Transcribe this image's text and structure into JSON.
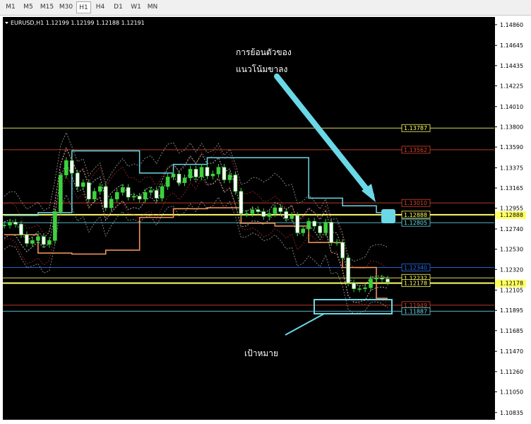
{
  "timeframes": [
    {
      "label": "M1",
      "active": false
    },
    {
      "label": "M5",
      "active": false
    },
    {
      "label": "M15",
      "active": false
    },
    {
      "label": "M30",
      "active": false
    },
    {
      "label": "H1",
      "active": true
    },
    {
      "label": "H4",
      "active": false
    },
    {
      "label": "D1",
      "active": false
    },
    {
      "label": "W1",
      "active": false
    },
    {
      "label": "MN",
      "active": false
    }
  ],
  "chart_header": {
    "symbol": "EURUSD,H1",
    "ohlc": "1.12199 1.12199 1.12188 1.12191"
  },
  "annotations": {
    "retrace_line1": "การย้อนตัวของ",
    "retrace_line2": "แนวโน้มขาลง",
    "target": "เป้าหมาย"
  },
  "colors": {
    "background": "#000000",
    "axis": "#ffffff",
    "yellow": "#ffff64",
    "red": "#d9442c",
    "blue": "#2b6ff0",
    "cyan": "#6ad8e6",
    "orange": "#ff9a5c",
    "green": "#3cd23c"
  },
  "chart_data": {
    "type": "candlestick",
    "symbol": "EURUSD",
    "timeframe": "H1",
    "last_price": 1.12178,
    "y_ticks": [
      1.1486,
      1.14645,
      1.14435,
      1.14225,
      1.1401,
      1.138,
      1.1359,
      1.13375,
      1.13165,
      1.12955,
      1.1274,
      1.1253,
      1.1232,
      1.12105,
      1.11895,
      1.11685,
      1.1147,
      1.1126,
      1.1105,
      1.10835
    ],
    "y_tick_labels": [
      "1.14860",
      "1.14645",
      "1.14435",
      "1.14225",
      "1.14010",
      "1.13800",
      "1.13590",
      "1.13375",
      "1.13165",
      "1.12955",
      "1.12740",
      "1.12530",
      "1.12320",
      "1.12105",
      "1.11895",
      "1.11685",
      "1.11470",
      "1.11260",
      "1.11050",
      "1.10835"
    ],
    "ylim": [
      1.1076,
      1.1494
    ],
    "levels": [
      {
        "value": 1.13787,
        "label": "1.13787",
        "color": "#ffff64"
      },
      {
        "value": 1.13562,
        "label": "1.13562",
        "color": "#d9442c"
      },
      {
        "value": 1.1301,
        "label": "1.13010",
        "color": "#d9442c"
      },
      {
        "value": 1.12888,
        "label": "1.12888",
        "color": "#ffff64",
        "highlight": true
      },
      {
        "value": 1.12805,
        "label": "1.12805",
        "color": "#6ad8e6"
      },
      {
        "value": 1.1234,
        "label": "1.12340",
        "color": "#2b6ff0"
      },
      {
        "value": 1.12232,
        "label": "1.12232",
        "color": "#ffff64"
      },
      {
        "value": 1.12178,
        "label": "1.12178",
        "color": "#ffff64",
        "highlight": true
      },
      {
        "value": 1.11949,
        "label": "1.11949",
        "color": "#d9442c"
      },
      {
        "value": 1.11887,
        "label": "1.11887",
        "color": "#6ad8e6"
      }
    ],
    "close": [
      1.1278,
      1.1281,
      1.1279,
      1.1268,
      1.1259,
      1.1262,
      1.1266,
      1.1258,
      1.1262,
      1.1292,
      1.133,
      1.1345,
      1.1332,
      1.1318,
      1.1322,
      1.1305,
      1.1313,
      1.1318,
      1.1296,
      1.1305,
      1.1312,
      1.1317,
      1.1307,
      1.1308,
      1.1305,
      1.1312,
      1.1314,
      1.1306,
      1.1318,
      1.1328,
      1.1331,
      1.1322,
      1.1327,
      1.1336,
      1.1328,
      1.1338,
      1.1329,
      1.1331,
      1.1338,
      1.1325,
      1.133,
      1.1313,
      1.129,
      1.129,
      1.1294,
      1.1292,
      1.1287,
      1.129,
      1.1296,
      1.1292,
      1.1285,
      1.1288,
      1.127,
      1.1274,
      1.1282,
      1.1277,
      1.127,
      1.1281,
      1.126,
      1.126,
      1.1244,
      1.1218,
      1.1212,
      1.1212,
      1.1213,
      1.1222,
      1.1223,
      1.1222,
      1.1219
    ]
  }
}
